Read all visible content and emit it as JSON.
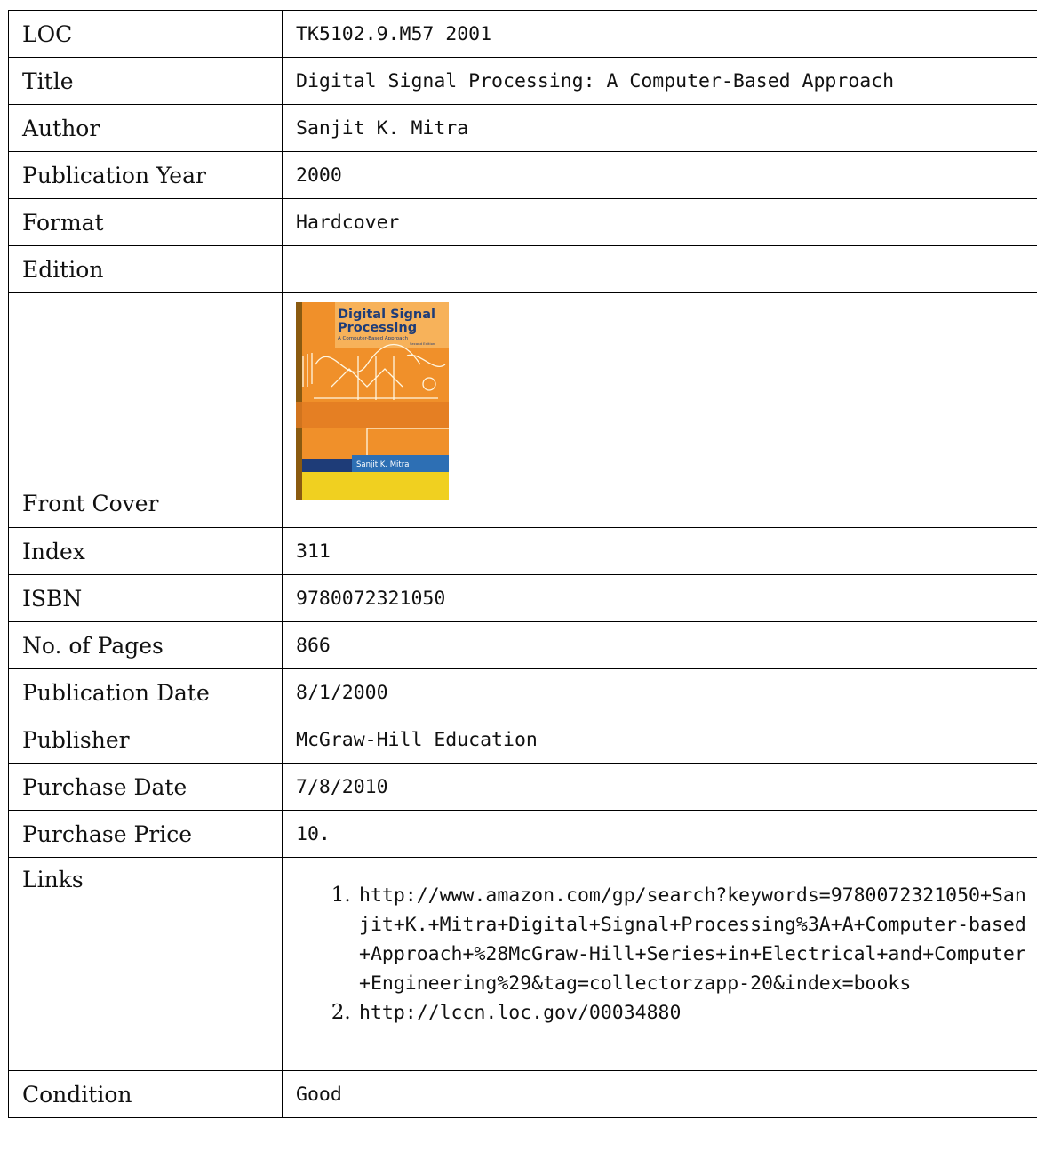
{
  "rows": [
    {
      "label": "LOC",
      "value": "TK5102.9.M57 2001"
    },
    {
      "label": "Title",
      "value": "Digital Signal Processing: A Computer-Based Approach"
    },
    {
      "label": "Author",
      "value": "Sanjit K. Mitra"
    },
    {
      "label": "Publication Year",
      "value": "2000"
    },
    {
      "label": "Format",
      "value": "Hardcover"
    },
    {
      "label": "Edition",
      "value": ""
    },
    {
      "label": "Front Cover"
    },
    {
      "label": "Index",
      "value": "311"
    },
    {
      "label": "ISBN",
      "value": "9780072321050"
    },
    {
      "label": "No. of Pages",
      "value": "866"
    },
    {
      "label": "Publication Date",
      "value": "8/1/2000"
    },
    {
      "label": "Publisher",
      "value": "McGraw-Hill Education"
    },
    {
      "label": "Purchase Date",
      "value": "7/8/2010"
    },
    {
      "label": "Purchase Price",
      "value": "10."
    },
    {
      "label": "Links"
    },
    {
      "label": "Condition",
      "value": "Good"
    }
  ],
  "cover": {
    "title_line1": "Digital Signal",
    "title_line2": "Processing",
    "subtitle": "A Computer-Based Approach",
    "edition_note": "Second Edition",
    "author": "Sanjit K. Mitra",
    "colors": {
      "orange": "#f0902a",
      "dark_orange": "#d86a18",
      "yellow": "#f0d020",
      "navy": "#1e3c78",
      "blue": "#2d6fb4"
    }
  },
  "links": [
    "http://www.amazon.com/gp/search?keywords=9780072321050+Sanjit+K.+Mitra+Digital+Signal+Processing%3A+A+Computer-based+Approach+%28McGraw-Hill+Series+in+Electrical+and+Computer+Engineering%29&tag=collectorzapp-20&index=books",
    "http://lccn.loc.gov/00034880"
  ]
}
